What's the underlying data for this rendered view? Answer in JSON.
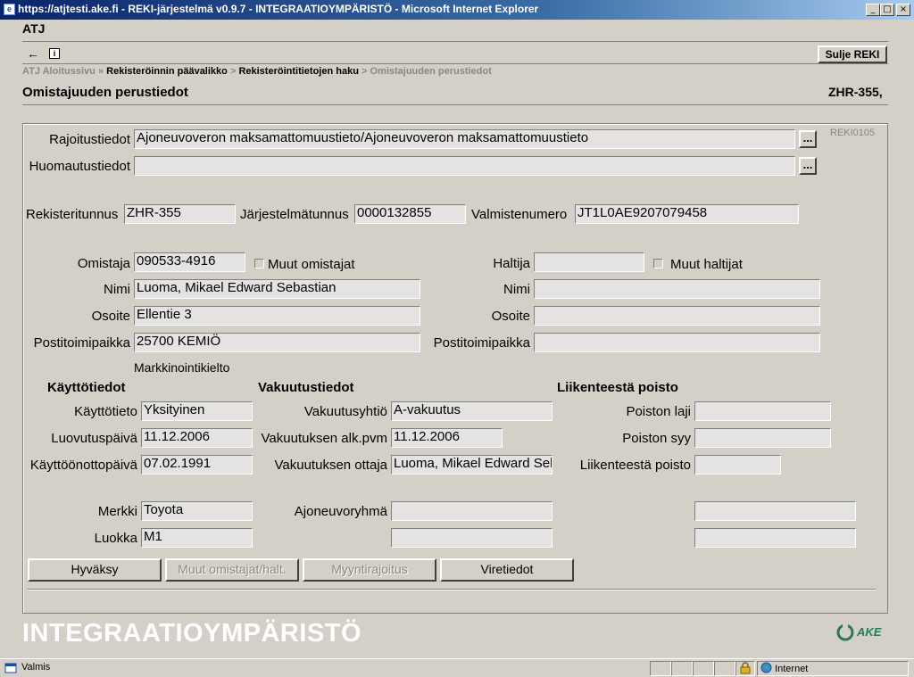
{
  "window": {
    "title": "https://atjtesti.ake.fi - REKI-järjestelmä v0.9.7 - INTEGRAATIOYMPÄRISTÖ - Microsoft Internet Explorer",
    "minimize": "_",
    "maximize": "□",
    "close": "×"
  },
  "app": {
    "name": "ATJ",
    "close_button": "Sulje REKI",
    "back_arrow": "←",
    "info": "i"
  },
  "breadcrumb": {
    "item1": "ATJ Aloitussivu",
    "sep1": "»",
    "item2": "Rekisteröinnin päävalikko",
    "sep2": ">",
    "item3": "Rekisteröintitietojen haku",
    "sep3": ">",
    "item4": "Omistajuuden perustiedot"
  },
  "page": {
    "title": "Omistajuuden perustiedot",
    "plate": "ZHR-355,",
    "code": "REKI0105"
  },
  "top": {
    "rajoitus_label": "Rajoitustiedot",
    "rajoitus_value": "Ajoneuvoveron maksamattomuustieto/Ajoneuvoveron maksamattomuustieto",
    "huom_label": "Huomautustiedot",
    "huom_value": "",
    "dots": "..."
  },
  "vehicle": {
    "rek_label": "Rekisteritunnus",
    "rek_value": "ZHR-355",
    "jarj_label": "Järjestelmätunnus",
    "jarj_value": "0000132855",
    "valm_label": "Valmistenumero",
    "valm_value": "JT1L0AE9207079458"
  },
  "owner": {
    "omistaja_label": "Omistaja",
    "omistaja_value": "090533-4916",
    "muut_omistajat": "Muut omistajat",
    "nimi_label": "Nimi",
    "nimi_value": "Luoma, Mikael Edward Sebastian",
    "osoite_label": "Osoite",
    "osoite_value": "Ellentie 3",
    "posti_label": "Postitoimipaikka",
    "posti_value": "25700 KEMIÖ",
    "markkinointi": "Markkinointikielto"
  },
  "holder": {
    "haltija_label": "Haltija",
    "haltija_value": "",
    "muut_haltijat": "Muut haltijat",
    "nimi_label": "Nimi",
    "nimi_value": "",
    "osoite_label": "Osoite",
    "osoite_value": "",
    "posti_label": "Postitoimipaikka",
    "posti_value": ""
  },
  "usage": {
    "title": "Käyttötiedot",
    "kaytto_label": "Käyttötieto",
    "kaytto_value": "Yksityinen",
    "luov_label": "Luovutuspäivä",
    "luov_value": "11.12.2006",
    "kayttoon_label": "Käyttöönottopäivä",
    "kayttoon_value": "07.02.1991",
    "merkki_label": "Merkki",
    "merkki_value": "Toyota",
    "luokka_label": "Luokka",
    "luokka_value": "M1"
  },
  "insurance": {
    "title": "Vakuutustiedot",
    "yhtio_label": "Vakuutusyhtiö",
    "yhtio_value": "A-vakuutus",
    "alk_label": "Vakuutuksen alk.pvm",
    "alk_value": "11.12.2006",
    "ottaja_label": "Vakuutuksen ottaja",
    "ottaja_value": "Luoma, Mikael Edward Sebastian",
    "ryhma_label": "Ajoneuvoryhmä",
    "ryhma_value": "",
    "extra_value": ""
  },
  "removal": {
    "title": "Liikenteestä poisto",
    "laji_label": "Poiston laji",
    "laji_value": "",
    "syy_label": "Poiston syy",
    "syy_value": "",
    "poisto_label": "Liikenteestä poisto",
    "poisto_value": "",
    "extra1": "",
    "extra2": ""
  },
  "buttons": {
    "hyvaksy": "Hyväksy",
    "muut": "Muut omistajat/halt.",
    "myynti": "Myyntirajoitus",
    "vire": "Viretiedot"
  },
  "footer": {
    "env": "INTEGRAATIOYMPÄRISTÖ",
    "logo": "AKE"
  },
  "status": {
    "text": "Valmis",
    "zone": "Internet"
  },
  "colors": {
    "title_start": "#0a246a",
    "title_end": "#a6caf0",
    "face": "#d4d0c8",
    "env_text": "#ffffff",
    "logo": "#2a7a5a"
  }
}
